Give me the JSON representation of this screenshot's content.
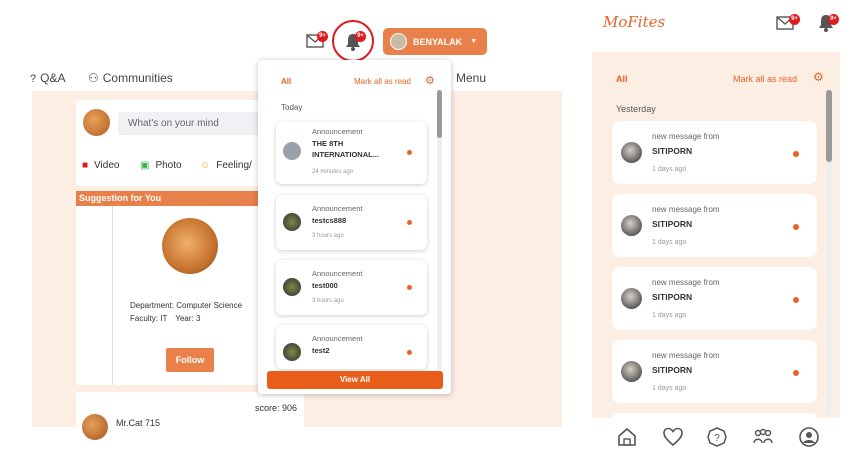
{
  "desktop": {
    "header": {
      "mail_badge": "9+",
      "bell_badge": "9+",
      "user_name": "BENYALAK"
    },
    "nav": {
      "qa": "Q&A",
      "communities": "Communities",
      "menu": "Menu"
    },
    "composer": {
      "placeholder": "What's on your mind",
      "video": "Video",
      "photo": "Photo",
      "feeling": "Feeling/"
    },
    "suggestion": {
      "header": "Suggestion for You",
      "department": "Department: Computer Science",
      "faculty": "Faculty: IT",
      "year": "Year: 3",
      "follow": "Follow"
    },
    "score_card": {
      "score": "score: 906",
      "name": "Mr.Cat 715"
    },
    "notifications": {
      "tab_all": "All",
      "mark_all": "Mark all as read",
      "section": "Today",
      "items": [
        {
          "type": "Announcement",
          "title": "THE 8TH INTERNATIONAL...",
          "time": "24 minutes ago"
        },
        {
          "type": "Announcement",
          "title": "testcs888",
          "time": "3 hours ago"
        },
        {
          "type": "Announcement",
          "title": "test000",
          "time": "3 hours ago"
        },
        {
          "type": "Announcement",
          "title": "test2",
          "time": ""
        }
      ],
      "view_all": "View All"
    }
  },
  "mobile": {
    "logo": "MoFites",
    "mail_badge": "9+",
    "bell_badge": "9+",
    "tab_all": "All",
    "mark_all": "Mark all as read",
    "section": "Yesterday",
    "items": [
      {
        "line1": "new message from",
        "name": "SITIPORN",
        "time": "1 days ago"
      },
      {
        "line1": "new message from",
        "name": "SITIPORN",
        "time": "1 days ago"
      },
      {
        "line1": "new message from",
        "name": "SITIPORN",
        "time": "1 days ago"
      },
      {
        "line1": "new message from",
        "name": "SITIPORN",
        "time": "1 days ago"
      }
    ]
  },
  "colors": {
    "accent": "#e8632a",
    "button": "#e8804a",
    "badge": "#e0191d",
    "feed_bg": "#fdeee3"
  }
}
